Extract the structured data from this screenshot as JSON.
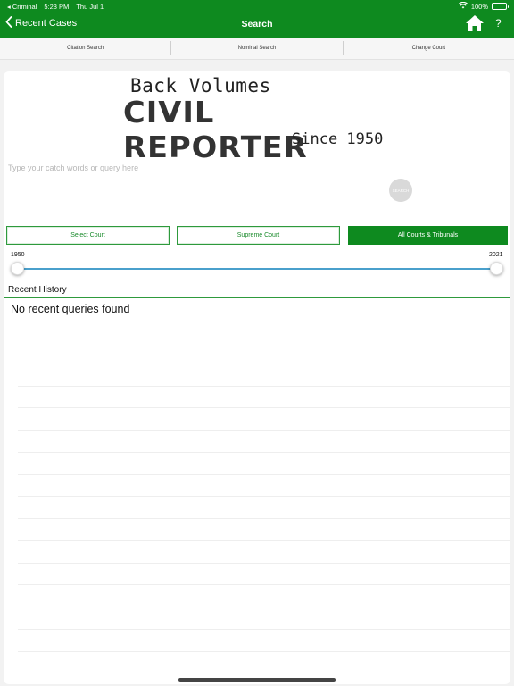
{
  "status_bar": {
    "back_app": "Criminal",
    "time": "5:23 PM",
    "date": "Thu Jul 1",
    "battery": "100%"
  },
  "nav": {
    "back_label": "Recent Cases",
    "title": "Search",
    "help_label": "?"
  },
  "tabs": [
    {
      "label": "Citation Search"
    },
    {
      "label": "Nominal Search"
    },
    {
      "label": "Change Court"
    }
  ],
  "logo": {
    "line1": "Back Volumes",
    "line2": "CIVIL REPORTER",
    "line3": "Since 1950"
  },
  "search": {
    "placeholder": "Type your catch words or query here",
    "value": "",
    "button_label": "SEARCH"
  },
  "court_buttons": [
    {
      "label": "Select Court",
      "active": false
    },
    {
      "label": "Supreme Court",
      "active": false
    },
    {
      "label": "All Courts & Tribunals",
      "active": true
    }
  ],
  "year_range": {
    "min_label": "1950",
    "max_label": "2021"
  },
  "history": {
    "header": "Recent History",
    "empty_message": "No recent queries found"
  },
  "colors": {
    "brand_green": "#0e8a1f",
    "slider_blue": "#4aa0cc"
  }
}
